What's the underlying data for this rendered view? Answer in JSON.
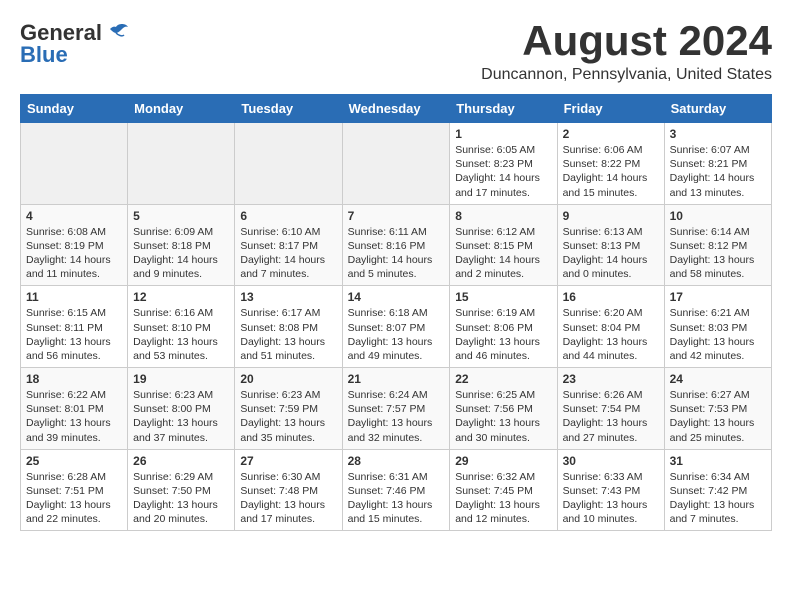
{
  "header": {
    "logo_general": "General",
    "logo_blue": "Blue",
    "month_title": "August 2024",
    "location": "Duncannon, Pennsylvania, United States"
  },
  "days_of_week": [
    "Sunday",
    "Monday",
    "Tuesday",
    "Wednesday",
    "Thursday",
    "Friday",
    "Saturday"
  ],
  "weeks": [
    [
      {
        "day": "",
        "info": ""
      },
      {
        "day": "",
        "info": ""
      },
      {
        "day": "",
        "info": ""
      },
      {
        "day": "",
        "info": ""
      },
      {
        "day": "1",
        "info": "Sunrise: 6:05 AM\nSunset: 8:23 PM\nDaylight: 14 hours\nand 17 minutes."
      },
      {
        "day": "2",
        "info": "Sunrise: 6:06 AM\nSunset: 8:22 PM\nDaylight: 14 hours\nand 15 minutes."
      },
      {
        "day": "3",
        "info": "Sunrise: 6:07 AM\nSunset: 8:21 PM\nDaylight: 14 hours\nand 13 minutes."
      }
    ],
    [
      {
        "day": "4",
        "info": "Sunrise: 6:08 AM\nSunset: 8:19 PM\nDaylight: 14 hours\nand 11 minutes."
      },
      {
        "day": "5",
        "info": "Sunrise: 6:09 AM\nSunset: 8:18 PM\nDaylight: 14 hours\nand 9 minutes."
      },
      {
        "day": "6",
        "info": "Sunrise: 6:10 AM\nSunset: 8:17 PM\nDaylight: 14 hours\nand 7 minutes."
      },
      {
        "day": "7",
        "info": "Sunrise: 6:11 AM\nSunset: 8:16 PM\nDaylight: 14 hours\nand 5 minutes."
      },
      {
        "day": "8",
        "info": "Sunrise: 6:12 AM\nSunset: 8:15 PM\nDaylight: 14 hours\nand 2 minutes."
      },
      {
        "day": "9",
        "info": "Sunrise: 6:13 AM\nSunset: 8:13 PM\nDaylight: 14 hours\nand 0 minutes."
      },
      {
        "day": "10",
        "info": "Sunrise: 6:14 AM\nSunset: 8:12 PM\nDaylight: 13 hours\nand 58 minutes."
      }
    ],
    [
      {
        "day": "11",
        "info": "Sunrise: 6:15 AM\nSunset: 8:11 PM\nDaylight: 13 hours\nand 56 minutes."
      },
      {
        "day": "12",
        "info": "Sunrise: 6:16 AM\nSunset: 8:10 PM\nDaylight: 13 hours\nand 53 minutes."
      },
      {
        "day": "13",
        "info": "Sunrise: 6:17 AM\nSunset: 8:08 PM\nDaylight: 13 hours\nand 51 minutes."
      },
      {
        "day": "14",
        "info": "Sunrise: 6:18 AM\nSunset: 8:07 PM\nDaylight: 13 hours\nand 49 minutes."
      },
      {
        "day": "15",
        "info": "Sunrise: 6:19 AM\nSunset: 8:06 PM\nDaylight: 13 hours\nand 46 minutes."
      },
      {
        "day": "16",
        "info": "Sunrise: 6:20 AM\nSunset: 8:04 PM\nDaylight: 13 hours\nand 44 minutes."
      },
      {
        "day": "17",
        "info": "Sunrise: 6:21 AM\nSunset: 8:03 PM\nDaylight: 13 hours\nand 42 minutes."
      }
    ],
    [
      {
        "day": "18",
        "info": "Sunrise: 6:22 AM\nSunset: 8:01 PM\nDaylight: 13 hours\nand 39 minutes."
      },
      {
        "day": "19",
        "info": "Sunrise: 6:23 AM\nSunset: 8:00 PM\nDaylight: 13 hours\nand 37 minutes."
      },
      {
        "day": "20",
        "info": "Sunrise: 6:23 AM\nSunset: 7:59 PM\nDaylight: 13 hours\nand 35 minutes."
      },
      {
        "day": "21",
        "info": "Sunrise: 6:24 AM\nSunset: 7:57 PM\nDaylight: 13 hours\nand 32 minutes."
      },
      {
        "day": "22",
        "info": "Sunrise: 6:25 AM\nSunset: 7:56 PM\nDaylight: 13 hours\nand 30 minutes."
      },
      {
        "day": "23",
        "info": "Sunrise: 6:26 AM\nSunset: 7:54 PM\nDaylight: 13 hours\nand 27 minutes."
      },
      {
        "day": "24",
        "info": "Sunrise: 6:27 AM\nSunset: 7:53 PM\nDaylight: 13 hours\nand 25 minutes."
      }
    ],
    [
      {
        "day": "25",
        "info": "Sunrise: 6:28 AM\nSunset: 7:51 PM\nDaylight: 13 hours\nand 22 minutes."
      },
      {
        "day": "26",
        "info": "Sunrise: 6:29 AM\nSunset: 7:50 PM\nDaylight: 13 hours\nand 20 minutes."
      },
      {
        "day": "27",
        "info": "Sunrise: 6:30 AM\nSunset: 7:48 PM\nDaylight: 13 hours\nand 17 minutes."
      },
      {
        "day": "28",
        "info": "Sunrise: 6:31 AM\nSunset: 7:46 PM\nDaylight: 13 hours\nand 15 minutes."
      },
      {
        "day": "29",
        "info": "Sunrise: 6:32 AM\nSunset: 7:45 PM\nDaylight: 13 hours\nand 12 minutes."
      },
      {
        "day": "30",
        "info": "Sunrise: 6:33 AM\nSunset: 7:43 PM\nDaylight: 13 hours\nand 10 minutes."
      },
      {
        "day": "31",
        "info": "Sunrise: 6:34 AM\nSunset: 7:42 PM\nDaylight: 13 hours\nand 7 minutes."
      }
    ]
  ]
}
